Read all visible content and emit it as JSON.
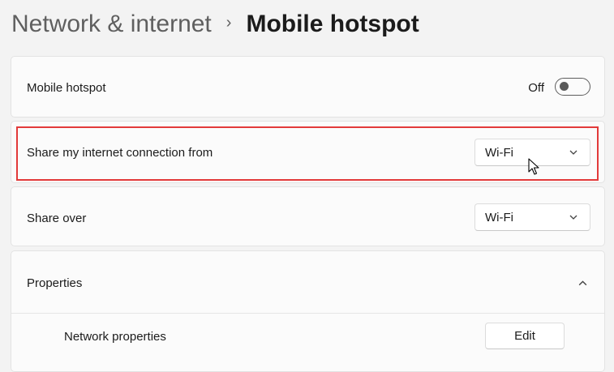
{
  "breadcrumb": {
    "parent": "Network & internet",
    "separator": "›",
    "current": "Mobile hotspot"
  },
  "mobile_hotspot": {
    "label": "Mobile hotspot",
    "state_label": "Off",
    "enabled": false
  },
  "share_from": {
    "label": "Share my internet connection from",
    "selected": "Wi-Fi"
  },
  "share_over": {
    "label": "Share over",
    "selected": "Wi-Fi"
  },
  "properties": {
    "label": "Properties",
    "expanded": true,
    "network_properties": {
      "label": "Network properties",
      "button_label": "Edit"
    }
  },
  "colors": {
    "background": "#f3f3f3",
    "card": "#fbfbfb",
    "highlight_border": "#e23a3a"
  },
  "icons": [
    "chevron-right-icon",
    "chevron-down-icon",
    "chevron-up-icon",
    "mouse-cursor-icon"
  ]
}
